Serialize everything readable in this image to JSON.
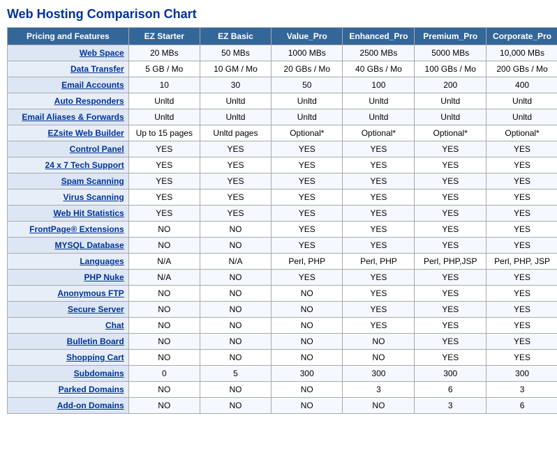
{
  "title": "Web Hosting Comparison Chart",
  "columns": [
    "Pricing and Features",
    "EZ Starter",
    "EZ Basic",
    "Value_Pro",
    "Enhanced_Pro",
    "Premium_Pro",
    "Corporate_Pro"
  ],
  "rows": [
    {
      "feature": "Web Space",
      "ez_starter": "20 MBs",
      "ez_basic": "50 MBs",
      "value_pro": "1000 MBs",
      "enhanced_pro": "2500 MBs",
      "premium_pro": "5000 MBs",
      "corporate_pro": "10,000 MBs"
    },
    {
      "feature": "Data Transfer",
      "ez_starter": "5 GB / Mo",
      "ez_basic": "10 GM / Mo",
      "value_pro": "20 GBs / Mo",
      "enhanced_pro": "40 GBs / Mo",
      "premium_pro": "100 GBs / Mo",
      "corporate_pro": "200 GBs / Mo"
    },
    {
      "feature": "Email Accounts",
      "ez_starter": "10",
      "ez_basic": "30",
      "value_pro": "50",
      "enhanced_pro": "100",
      "premium_pro": "200",
      "corporate_pro": "400"
    },
    {
      "feature": "Auto Responders",
      "ez_starter": "Unltd",
      "ez_basic": "Unltd",
      "value_pro": "Unltd",
      "enhanced_pro": "Unltd",
      "premium_pro": "Unltd",
      "corporate_pro": "Unltd"
    },
    {
      "feature": "Email Aliases & Forwards",
      "ez_starter": "Unltd",
      "ez_basic": "Unltd",
      "value_pro": "Unltd",
      "enhanced_pro": "Unltd",
      "premium_pro": "Unltd",
      "corporate_pro": "Unltd"
    },
    {
      "feature": "EZsite Web Builder",
      "ez_starter": "Up to 15 pages",
      "ez_basic": "Unltd pages",
      "value_pro": "Optional*",
      "enhanced_pro": "Optional*",
      "premium_pro": "Optional*",
      "corporate_pro": "Optional*"
    },
    {
      "feature": "Control Panel",
      "ez_starter": "YES",
      "ez_basic": "YES",
      "value_pro": "YES",
      "enhanced_pro": "YES",
      "premium_pro": "YES",
      "corporate_pro": "YES"
    },
    {
      "feature": "24 x 7 Tech Support",
      "ez_starter": "YES",
      "ez_basic": "YES",
      "value_pro": "YES",
      "enhanced_pro": "YES",
      "premium_pro": "YES",
      "corporate_pro": "YES"
    },
    {
      "feature": "Spam Scanning",
      "ez_starter": "YES",
      "ez_basic": "YES",
      "value_pro": "YES",
      "enhanced_pro": "YES",
      "premium_pro": "YES",
      "corporate_pro": "YES"
    },
    {
      "feature": "Virus Scanning",
      "ez_starter": "YES",
      "ez_basic": "YES",
      "value_pro": "YES",
      "enhanced_pro": "YES",
      "premium_pro": "YES",
      "corporate_pro": "YES"
    },
    {
      "feature": "Web Hit Statistics",
      "ez_starter": "YES",
      "ez_basic": "YES",
      "value_pro": "YES",
      "enhanced_pro": "YES",
      "premium_pro": "YES",
      "corporate_pro": "YES"
    },
    {
      "feature": "FrontPage® Extensions",
      "ez_starter": "NO",
      "ez_basic": "NO",
      "value_pro": "YES",
      "enhanced_pro": "YES",
      "premium_pro": "YES",
      "corporate_pro": "YES"
    },
    {
      "feature": "MYSQL Database",
      "ez_starter": "NO",
      "ez_basic": "NO",
      "value_pro": "YES",
      "enhanced_pro": "YES",
      "premium_pro": "YES",
      "corporate_pro": "YES"
    },
    {
      "feature": "Languages",
      "ez_starter": "N/A",
      "ez_basic": "N/A",
      "value_pro": "Perl, PHP",
      "enhanced_pro": "Perl, PHP",
      "premium_pro": "Perl, PHP,JSP",
      "corporate_pro": "Perl, PHP, JSP"
    },
    {
      "feature": "PHP Nuke",
      "ez_starter": "N/A",
      "ez_basic": "NO",
      "value_pro": "YES",
      "enhanced_pro": "YES",
      "premium_pro": "YES",
      "corporate_pro": "YES"
    },
    {
      "feature": "Anonymous FTP",
      "ez_starter": "NO",
      "ez_basic": "NO",
      "value_pro": "NO",
      "enhanced_pro": "YES",
      "premium_pro": "YES",
      "corporate_pro": "YES"
    },
    {
      "feature": "Secure Server",
      "ez_starter": "NO",
      "ez_basic": "NO",
      "value_pro": "NO",
      "enhanced_pro": "YES",
      "premium_pro": "YES",
      "corporate_pro": "YES"
    },
    {
      "feature": "Chat",
      "ez_starter": "NO",
      "ez_basic": "NO",
      "value_pro": "NO",
      "enhanced_pro": "YES",
      "premium_pro": "YES",
      "corporate_pro": "YES"
    },
    {
      "feature": "Bulletin Board",
      "ez_starter": "NO",
      "ez_basic": "NO",
      "value_pro": "NO",
      "enhanced_pro": "NO",
      "premium_pro": "YES",
      "corporate_pro": "YES"
    },
    {
      "feature": "Shopping Cart",
      "ez_starter": "NO",
      "ez_basic": "NO",
      "value_pro": "NO",
      "enhanced_pro": "NO",
      "premium_pro": "YES",
      "corporate_pro": "YES"
    },
    {
      "feature": "Subdomains",
      "ez_starter": "0",
      "ez_basic": "5",
      "value_pro": "300",
      "enhanced_pro": "300",
      "premium_pro": "300",
      "corporate_pro": "300"
    },
    {
      "feature": "Parked Domains",
      "ez_starter": "NO",
      "ez_basic": "NO",
      "value_pro": "NO",
      "enhanced_pro": "3",
      "premium_pro": "6",
      "corporate_pro": "3"
    },
    {
      "feature": "Add-on Domains",
      "ez_starter": "NO",
      "ez_basic": "NO",
      "value_pro": "NO",
      "enhanced_pro": "NO",
      "premium_pro": "3",
      "corporate_pro": "6"
    }
  ]
}
